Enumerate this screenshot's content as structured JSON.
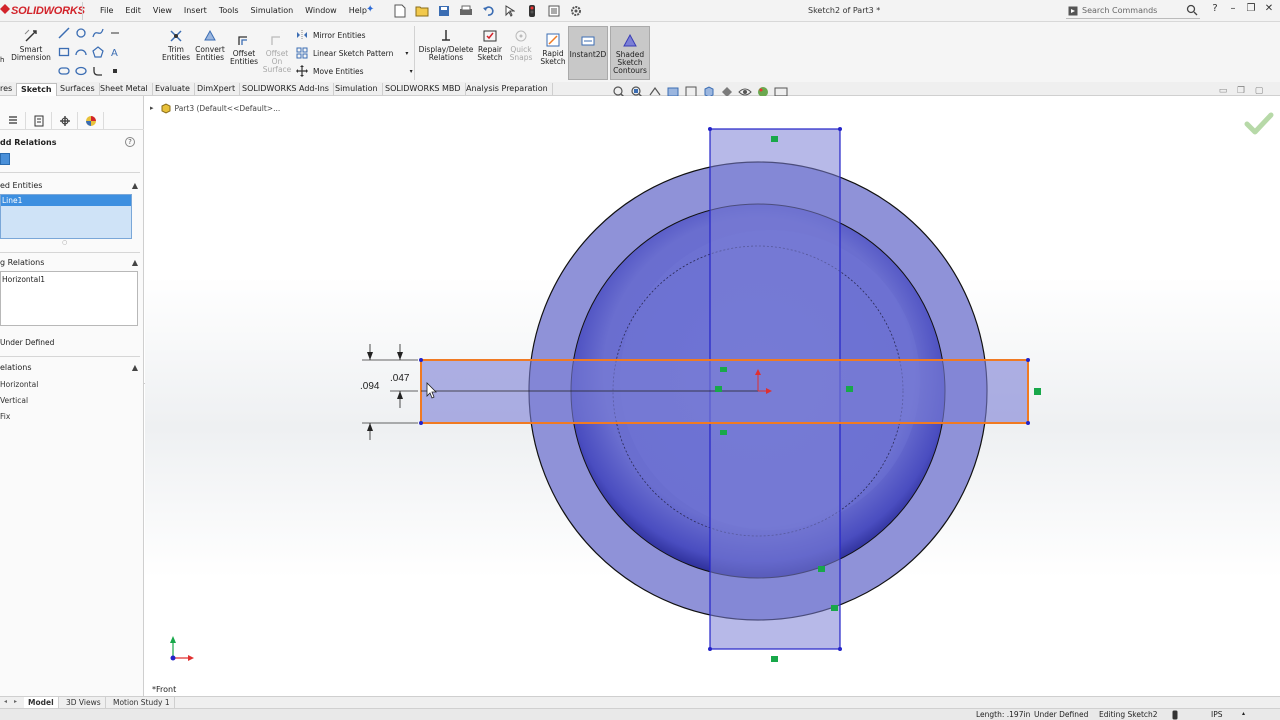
{
  "app": {
    "logo": "SOLIDWORKS",
    "document_title": "Sketch2 of Part3 *"
  },
  "menu": [
    "File",
    "Edit",
    "View",
    "Insert",
    "Tools",
    "Simulation",
    "Window",
    "Help"
  ],
  "search": {
    "placeholder": "Search Commands"
  },
  "ribbon": {
    "smart_dimension": "Smart Dimension",
    "trim_entities": "Trim Entities",
    "convert_entities": "Convert Entities",
    "offset_entities": "Offset Entities",
    "offset_on_surface": "Offset On Surface",
    "mirror_entities": "Mirror Entities",
    "linear_sketch_pattern": "Linear Sketch Pattern",
    "move_entities": "Move Entities",
    "display_delete_relations": "Display/Delete Relations",
    "repair_sketch": "Repair Sketch",
    "quick_snaps": "Quick Snaps",
    "rapid_sketch": "Rapid Sketch",
    "instant2d": "Instant2D",
    "shaded_sketch_contours": "Shaded Sketch Contours"
  },
  "tabs": [
    {
      "label": "res"
    },
    {
      "label": "Sketch",
      "active": true
    },
    {
      "label": "Surfaces"
    },
    {
      "label": "Sheet Metal"
    },
    {
      "label": "Evaluate"
    },
    {
      "label": "DimXpert"
    },
    {
      "label": "SOLIDWORKS Add-Ins"
    },
    {
      "label": "Simulation"
    },
    {
      "label": "SOLIDWORKS MBD"
    },
    {
      "label": "Analysis Preparation"
    }
  ],
  "property_manager": {
    "title": "dd Relations",
    "help": "?",
    "selected_entities_header": "ed Entities",
    "selected_item": "Line1",
    "existing_relations_header": "g Relations",
    "existing_relation_item": "Horizontal1",
    "status": "Under Defined",
    "add_relations_header": "elations",
    "add_relations_items": [
      "Horizontal",
      "Vertical",
      "Fix"
    ]
  },
  "feature_tree": {
    "crumb": "Part3  (Default<<Default>..."
  },
  "dimensions": {
    "outer": ".094",
    "inner": ".047"
  },
  "view": {
    "orientation": "*Front"
  },
  "bottom_tabs": [
    {
      "label": "Model",
      "active": true
    },
    {
      "label": "3D Views"
    },
    {
      "label": "Motion Study 1"
    }
  ],
  "status_bar": {
    "length": "Length: .197in",
    "defined": "Under Defined",
    "editing": "Editing Sketch2",
    "units": "IPS"
  },
  "colors": {
    "sketch_fill": "#7b7fd6",
    "selection": "#f07a22",
    "circle_dark": "#3a3db5",
    "accent_blue": "#3d8fe0"
  }
}
